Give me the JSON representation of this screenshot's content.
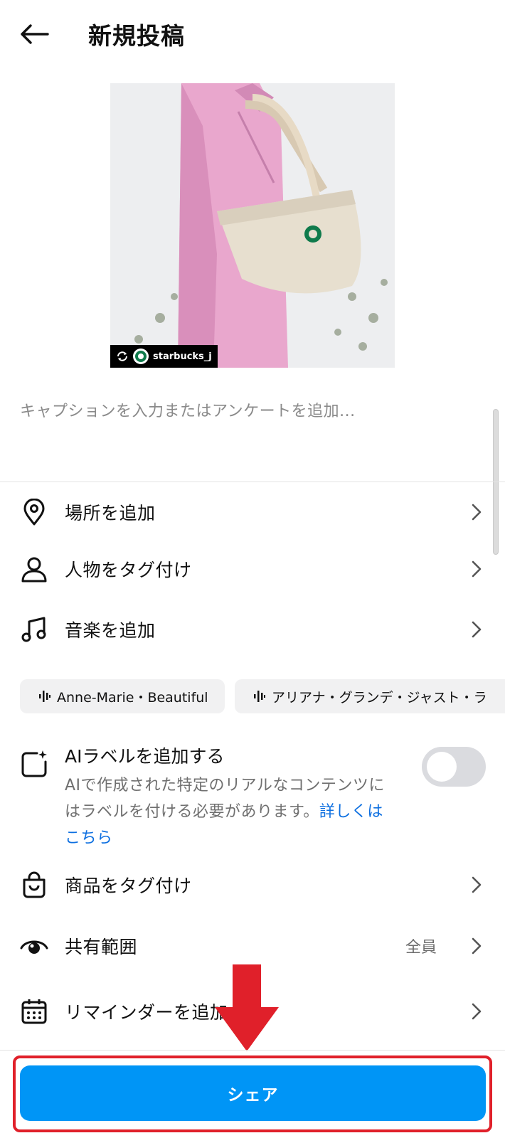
{
  "header": {
    "title": "新規投稿",
    "back_icon": "arrow-left-icon"
  },
  "photo": {
    "badge_text": "starbucks_j",
    "repost_icon": "repost-icon"
  },
  "caption": {
    "placeholder": "キャプションを入力またはアンケートを追加..."
  },
  "rows": [
    {
      "label": "場所を追加",
      "icon": "location-pin-icon"
    },
    {
      "label": "人物をタグ付け",
      "icon": "person-icon"
    },
    {
      "label": "音楽を追加",
      "icon": "music-note-icon"
    }
  ],
  "music_suggestions": [
    {
      "label": "Anne-Marie・Beautiful"
    },
    {
      "label": "アリアナ・グランデ・ジャスト・ラ"
    }
  ],
  "ai_label": {
    "title": "AIラベルを追加する",
    "description": "AIで作成された特定のリアルなコンテンツにはラベルを付ける必要があります。",
    "link_text": "詳しくはこちら",
    "toggle_on": false
  },
  "rows2": [
    {
      "label": "商品をタグ付け",
      "icon": "shopping-bag-icon"
    },
    {
      "label": "共有範囲",
      "icon": "eye-icon",
      "value": "全員"
    },
    {
      "label": "リマインダーを追加",
      "icon": "calendar-icon"
    }
  ],
  "share": {
    "label": "シェア"
  },
  "colors": {
    "accent": "#0095f6",
    "link": "#0d6fe0",
    "annotation": "#e0202a"
  }
}
